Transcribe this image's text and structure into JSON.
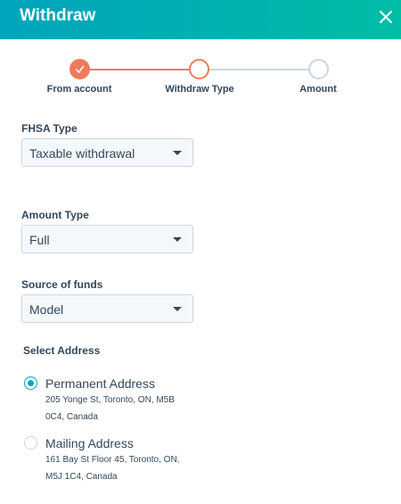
{
  "header": {
    "title": "Withdraw",
    "close_icon": "close-icon"
  },
  "stepper": {
    "steps": [
      {
        "label": "From account",
        "state": "completed"
      },
      {
        "label": "Withdraw Type",
        "state": "active"
      },
      {
        "label": "Amount",
        "state": "pending"
      }
    ],
    "colors": {
      "completed": "#f07b5b",
      "pending": "#cbd6e2"
    }
  },
  "fields": {
    "fhsa_type": {
      "label": "FHSA Type",
      "value": "Taxable withdrawal"
    },
    "amount_type": {
      "label": "Amount Type",
      "value": "Full"
    },
    "source_of_funds": {
      "label": "Source of funds",
      "value": "Model"
    }
  },
  "address": {
    "label": "Select Address",
    "options": [
      {
        "title": "Permanent Address",
        "line1": "205 Yonge St, Toronto, ON, M5B",
        "line2": "0C4, Canada",
        "selected": true
      },
      {
        "title": "Mailing Address",
        "line1": "161 Bay St Floor 45, Toronto, ON,",
        "line2": "M5J 1C4, Canada",
        "selected": false
      }
    ]
  },
  "theme": {
    "header_gradient_start": "#00a4bd",
    "header_gradient_end": "#00bda5",
    "accent": "#00a4bd"
  }
}
